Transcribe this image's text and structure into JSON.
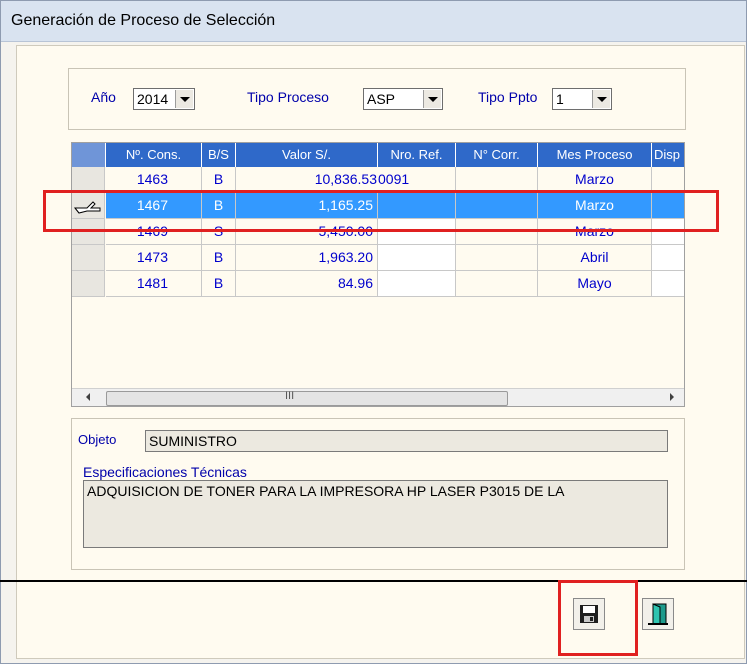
{
  "window": {
    "title": "Generación de Proceso de Selección"
  },
  "filters": {
    "anio_label": "Año",
    "anio_value": "2014",
    "tipo_proceso_label": "Tipo Proceso",
    "tipo_proceso_value": "ASP",
    "tipo_ppto_label": "Tipo Ppto",
    "tipo_ppto_value": "1"
  },
  "grid": {
    "columns": [
      "Nº. Cons.",
      "B/S",
      "Valor S/.",
      "Nro. Ref.",
      "N° Corr.",
      "Mes Proceso",
      "Disp"
    ],
    "rows": [
      {
        "cons": "1463",
        "bs": "B",
        "valor": "10,836.53",
        "ref": "0091",
        "corr": "",
        "mes": "Marzo"
      },
      {
        "cons": "1467",
        "bs": "B",
        "valor": "1,165.25",
        "ref": "",
        "corr": "",
        "mes": "Marzo"
      },
      {
        "cons": "1469",
        "bs": "S",
        "valor": "5,450.00",
        "ref": "",
        "corr": "",
        "mes": "Marzo"
      },
      {
        "cons": "1473",
        "bs": "B",
        "valor": "1,963.20",
        "ref": "",
        "corr": "",
        "mes": "Abril"
      },
      {
        "cons": "1481",
        "bs": "B",
        "valor": "84.96",
        "ref": "",
        "corr": "",
        "mes": "Mayo"
      }
    ],
    "scroll_mark": "III"
  },
  "details": {
    "objeto_label": "Objeto",
    "objeto_value": "SUMINISTRO",
    "especificaciones_label": "Especificaciones Técnicas",
    "especificaciones_value": "ADQUISICION DE TONER PARA LA IMPRESORA HP LASER P3015 DE LA"
  },
  "actions": {
    "save_icon": "floppy-disk-icon",
    "exit_icon": "exit-door-icon"
  },
  "colors": {
    "header_blue": "#2f69c9",
    "selected_row": "#3399ff",
    "highlight_red": "#e02020"
  }
}
